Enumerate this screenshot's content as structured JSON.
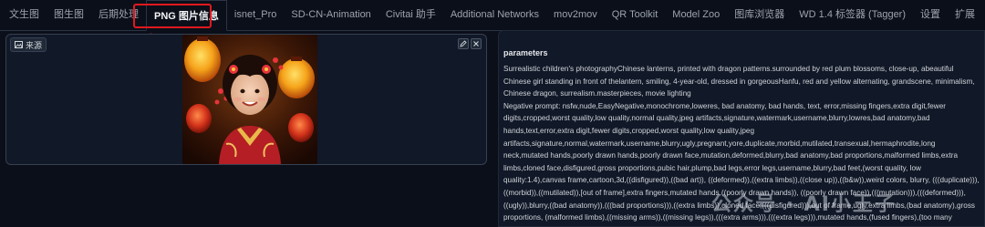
{
  "tabs": [
    {
      "label": "文生图"
    },
    {
      "label": "图生图"
    },
    {
      "label": "后期处理"
    },
    {
      "label": "PNG 图片信息"
    },
    {
      "label": "isnet_Pro"
    },
    {
      "label": "SD-CN-Animation"
    },
    {
      "label": "Civitai 助手"
    },
    {
      "label": "Additional Networks"
    },
    {
      "label": "mov2mov"
    },
    {
      "label": "QR Toolkit"
    },
    {
      "label": "Model Zoo"
    },
    {
      "label": "图库浏览器"
    },
    {
      "label": "WD 1.4 标签器 (Tagger)"
    },
    {
      "label": "设置"
    },
    {
      "label": "扩展"
    }
  ],
  "active_tab": "PNG 图片信息",
  "source_panel": {
    "label": "来源",
    "icon": "image-icon",
    "edit_icon": "pencil-icon",
    "close_icon": "close-icon"
  },
  "parameters": {
    "title": "parameters",
    "text": "Surrealistic children's photographyChinese lanterns, printed with dragon patterns.surrounded by red plum blossoms, close-up, abeautiful Chinese girl standing in front of thelantern, smiling, 4-year-old, dressed in gorgeousHanfu, red and yellow alternating, grandscene, minimalism, Chinese dragon, surrealism.masterpieces, movie lighting\nNegative prompt: nsfw,nude,EasyNegative,monochrome,loweres, bad anatomy, bad hands, text, error,missing fingers,extra digit,fewer digits,cropped,worst quality,low quality,normal quality,jpeg artifacts,signature,watermark,username,blurry,lowres,bad anatomy,bad hands,text,error,extra digit,fewer digits,cropped,worst quality,low quality,jpeg artifacts,signature,normal,watermark,username,blurry,ugly,pregnant,yore,duplicate,morbid,mutilated,transexual,hermaphrodite,long neck,mutated hands,poorly drawn hands,poorly drawn face,mutation,deformed,blurry,bad anatomy,bad proportions,malformed limbs,extra limbs,cloned face,disfigured,gross proportions,pubic hair,plump,bad legs,error legs,username,blurry,bad feet,(worst quality, low quality:1.4),canvas frame,cartoon,3d,((disfigured)),((bad art)), ((deformed)),((extra limbs)),((close up)),((b&w)),weird colors, blurry, (((duplicate))),((morbid)),((mutilated)),[out of frame],extra fingers,mutated hands,((poorly drawn hands)), ((poorly drawn face)),(((mutation))),(((deformed))),((ugly)),blurry,((bad anatomy)),(((bad proportions))),((extra limbs)),cloned face,(((disfigured))),out of frame,ugly,extra limbs,(bad anatomy),gross proportions, (malformed limbs),((missing arms)),((missing legs)),(((extra arms))),(((extra legs))),mutated hands,(fused fingers),(too many fingers),(((long neck))),video game,ugly,tiling,poorly drawn hands,poorly drawn feet,poorly"
  },
  "watermark": "公众号 · AI小王子",
  "colors": {
    "background": "#0b0f19",
    "panel": "#111827",
    "highlight_red": "#e0191e"
  }
}
